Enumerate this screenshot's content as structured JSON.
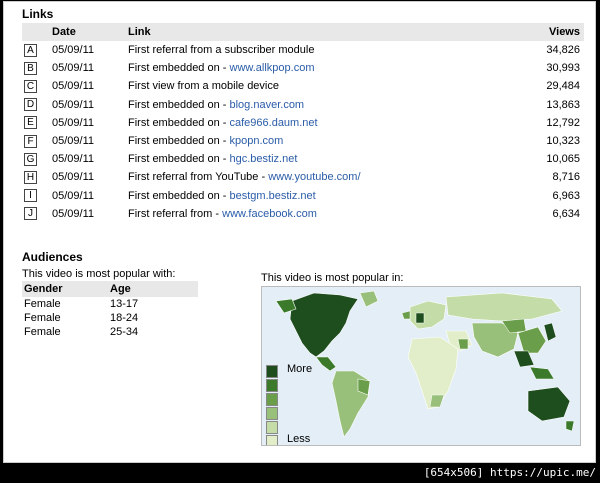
{
  "links": {
    "title": "Links",
    "headers": {
      "date": "Date",
      "link": "Link",
      "views": "Views"
    },
    "rows": [
      {
        "letter": "A",
        "date": "05/09/11",
        "prefix": "First referral from a subscriber module",
        "link": "",
        "views": "34,826"
      },
      {
        "letter": "B",
        "date": "05/09/11",
        "prefix": "First embedded on - ",
        "link": "www.allkpop.com",
        "views": "30,993"
      },
      {
        "letter": "C",
        "date": "05/09/11",
        "prefix": "First view from a mobile device",
        "link": "",
        "views": "29,484"
      },
      {
        "letter": "D",
        "date": "05/09/11",
        "prefix": "First embedded on - ",
        "link": "blog.naver.com",
        "views": "13,863"
      },
      {
        "letter": "E",
        "date": "05/09/11",
        "prefix": "First embedded on - ",
        "link": "cafe966.daum.net",
        "views": "12,792"
      },
      {
        "letter": "F",
        "date": "05/09/11",
        "prefix": "First embedded on - ",
        "link": "kpopn.com",
        "views": "10,323"
      },
      {
        "letter": "G",
        "date": "05/09/11",
        "prefix": "First embedded on - ",
        "link": "hgc.bestiz.net",
        "views": "10,065"
      },
      {
        "letter": "H",
        "date": "05/09/11",
        "prefix": "First referral from YouTube - ",
        "link": "www.youtube.com/",
        "views": "8,716"
      },
      {
        "letter": "I",
        "date": "05/09/11",
        "prefix": "First embedded on - ",
        "link": "bestgm.bestiz.net",
        "views": "6,963"
      },
      {
        "letter": "J",
        "date": "05/09/11",
        "prefix": "First referral from - ",
        "link": "www.facebook.com",
        "views": "6,634"
      }
    ]
  },
  "audiences": {
    "title": "Audiences",
    "subtitle": "This video is most popular with:",
    "headers": {
      "gender": "Gender",
      "age": "Age"
    },
    "rows": [
      {
        "gender": "Female",
        "age": "13-17"
      },
      {
        "gender": "Female",
        "age": "18-24"
      },
      {
        "gender": "Female",
        "age": "25-34"
      }
    ]
  },
  "map": {
    "caption": "This video is most popular in:",
    "legend_more": "More",
    "legend_less": "Less",
    "legend_colors": [
      "#1e4d1e",
      "#3b7a2a",
      "#6a9e4a",
      "#98c07a",
      "#c4dca8",
      "#e2eec9"
    ]
  },
  "footer": {
    "text": "[654x506] https://upic.me/"
  }
}
